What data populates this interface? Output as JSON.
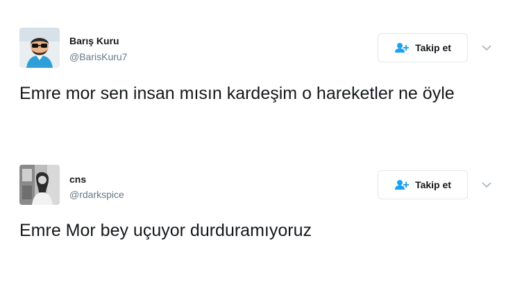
{
  "colors": {
    "text": "#14171a",
    "secondary": "#657786",
    "button_border": "#e1e8ed",
    "accent": "#1da1f2"
  },
  "tweets": [
    {
      "display_name": "Barış Kuru",
      "handle": "@BarisKuru7",
      "follow_label": "Takip et",
      "text": "Emre mor sen insan mısın kardeşim o hareketler ne öyle",
      "icons": {
        "follow": "add-user-icon",
        "menu": "chevron-down-icon"
      }
    },
    {
      "display_name": "cns",
      "handle": "@rdarkspice",
      "follow_label": "Takip et",
      "text": "Emre Mor bey uçuyor durduramıyoruz",
      "icons": {
        "follow": "add-user-icon",
        "menu": "chevron-down-icon"
      }
    }
  ]
}
